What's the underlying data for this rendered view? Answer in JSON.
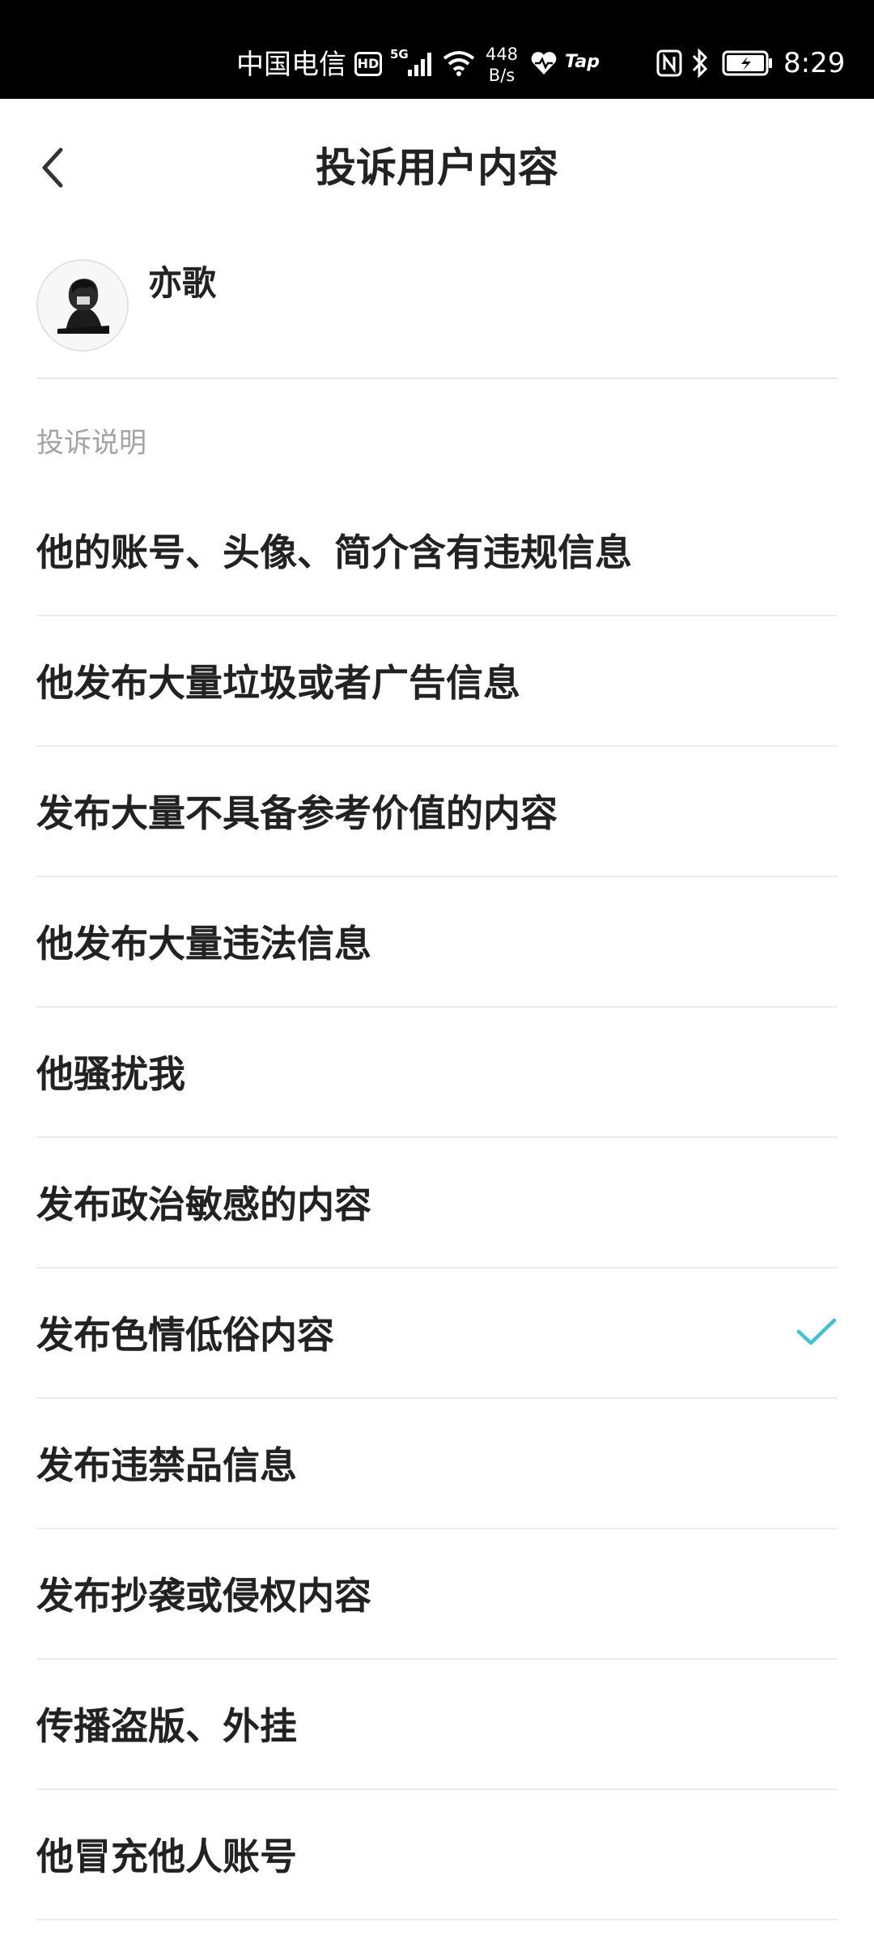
{
  "status_bar": {
    "carrier": "中国电信",
    "hd_badge": "HD",
    "network": "5G",
    "speed_value": "448",
    "speed_unit": "B/s",
    "tap_label": "Tap",
    "time": "8:29"
  },
  "header": {
    "title": "投诉用户内容",
    "back_icon": "chevron-left-icon"
  },
  "user": {
    "name": "亦歌",
    "avatar_icon": "user-avatar"
  },
  "section_label": "投诉说明",
  "options": [
    {
      "label": "他的账号、头像、简介含有违规信息",
      "selected": false
    },
    {
      "label": "他发布大量垃圾或者广告信息",
      "selected": false
    },
    {
      "label": "发布大量不具备参考价值的内容",
      "selected": false
    },
    {
      "label": "他发布大量违法信息",
      "selected": false
    },
    {
      "label": "他骚扰我",
      "selected": false
    },
    {
      "label": "发布政治敏感的内容",
      "selected": false
    },
    {
      "label": "发布色情低俗内容",
      "selected": true
    },
    {
      "label": "发布违禁品信息",
      "selected": false
    },
    {
      "label": "发布抄袭或侵权内容",
      "selected": false
    },
    {
      "label": "传播盗版、外挂",
      "selected": false
    },
    {
      "label": "他冒充他人账号",
      "selected": false
    }
  ],
  "colors": {
    "accent_check": "#3cc3d4",
    "divider": "#ececec",
    "muted_text": "#a3a3a3"
  }
}
